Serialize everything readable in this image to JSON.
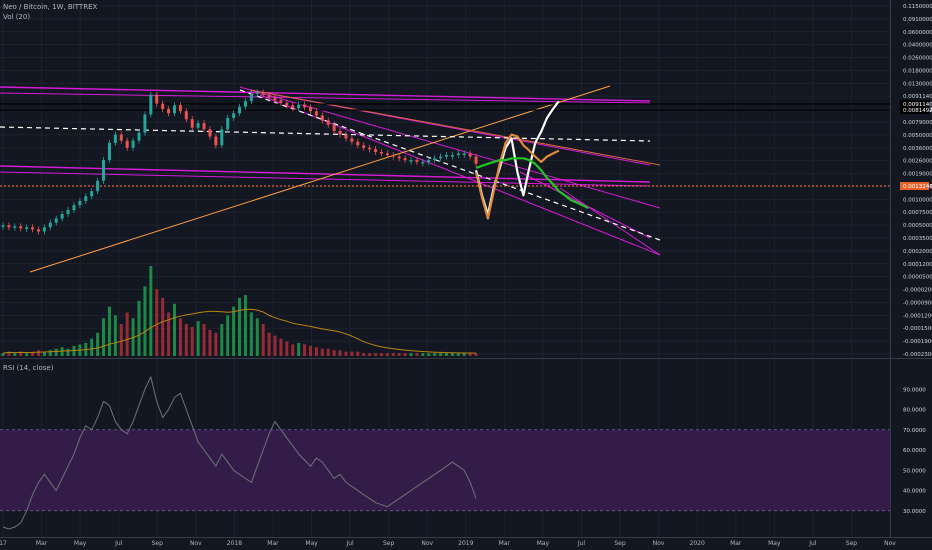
{
  "header": {
    "title": "Neo / Bitcoin, 1W, BITTREX",
    "vol_label": "Vol (20)",
    "rsi_label": "RSI (14, close)"
  },
  "colors": {
    "background": "#131722",
    "up": "#26a69a",
    "down": "#ef5350",
    "magenta": "#d81bd8",
    "orange": "#ff9f43",
    "projection_white": "#ffffff",
    "projection_orange": "#e0893a",
    "projection_green": "#22c322",
    "rsi_line": "#6d7479",
    "rsi_band": "#3a1e4f"
  },
  "chart_data": [
    {
      "type": "line",
      "title": "Neo / Bitcoin, 1W, BITTREX",
      "scale": "log",
      "x_ticks": [
        "17",
        "Mar",
        "May",
        "Jul",
        "Sep",
        "Nov",
        "2018",
        "Mar",
        "May",
        "Jul",
        "Sep",
        "Nov",
        "2019",
        "Mar",
        "May",
        "Jul",
        "Sep",
        "Nov",
        "2020",
        "Mar",
        "May",
        "Jul",
        "Sep",
        "Nov"
      ],
      "y_ticks": [
        "0.1150000",
        "0.0910000",
        "0.0600000",
        "0.0400000",
        "0.0260000",
        "0.0180000",
        "0.0130000",
        "0.0091140",
        "0.0081492",
        "0.0079000",
        "0.0050000",
        "0.0036000",
        "0.0026000",
        "0.0019000",
        "0.0013246",
        "0.0010000",
        "0.0007500",
        "0.0005000",
        "0.0003500",
        "0.0002000",
        "0.0001200",
        "0.0000500",
        "-0.0000200",
        "-0.0000900",
        "-0.0001200",
        "-0.0001500",
        "-0.0001900",
        "-0.0002300"
      ],
      "price_markers": [
        "0.0091140",
        "0.0081492",
        "0.0013246"
      ],
      "price": {
        "name": "",
        "points": [
          [
            0,
            0.00042
          ],
          [
            1,
            0.0004
          ],
          [
            2,
            0.00041
          ],
          [
            3,
            0.00039
          ],
          [
            4,
            0.0004
          ],
          [
            5,
            0.00038
          ],
          [
            6,
            0.00036
          ],
          [
            7,
            0.0004
          ],
          [
            8,
            0.00045
          ],
          [
            9,
            0.0005
          ],
          [
            10,
            0.00056
          ],
          [
            11,
            0.00062
          ],
          [
            12,
            0.0007
          ],
          [
            13,
            0.00078
          ],
          [
            14,
            0.00088
          ],
          [
            15,
            0.001
          ],
          [
            16,
            0.0013
          ],
          [
            17,
            0.0022
          ],
          [
            18,
            0.0034
          ],
          [
            19,
            0.0042
          ],
          [
            20,
            0.0036
          ],
          [
            21,
            0.003
          ],
          [
            22,
            0.0036
          ],
          [
            23,
            0.0044
          ],
          [
            24,
            0.007
          ],
          [
            25,
            0.0115
          ],
          [
            26,
            0.0092
          ],
          [
            27,
            0.008
          ],
          [
            28,
            0.0072
          ],
          [
            29,
            0.0088
          ],
          [
            30,
            0.0076
          ],
          [
            31,
            0.0062
          ],
          [
            32,
            0.005
          ],
          [
            33,
            0.0056
          ],
          [
            34,
            0.0048
          ],
          [
            35,
            0.004
          ],
          [
            36,
            0.0032
          ],
          [
            37,
            0.0048
          ],
          [
            38,
            0.0064
          ],
          [
            39,
            0.0072
          ],
          [
            40,
            0.0085
          ],
          [
            41,
            0.0098
          ],
          [
            42,
            0.0118
          ],
          [
            43,
            0.0122
          ],
          [
            44,
            0.0115
          ],
          [
            45,
            0.0108
          ],
          [
            46,
            0.01
          ],
          [
            47,
            0.0094
          ],
          [
            48,
            0.0088
          ],
          [
            49,
            0.0082
          ],
          [
            50,
            0.009
          ],
          [
            51,
            0.0084
          ],
          [
            52,
            0.0076
          ],
          [
            53,
            0.0068
          ],
          [
            54,
            0.006
          ],
          [
            55,
            0.0054
          ],
          [
            56,
            0.0046
          ],
          [
            57,
            0.0042
          ],
          [
            58,
            0.0038
          ],
          [
            59,
            0.0035
          ],
          [
            60,
            0.0032
          ],
          [
            61,
            0.003
          ],
          [
            62,
            0.0029
          ],
          [
            63,
            0.0027
          ],
          [
            64,
            0.0026
          ],
          [
            65,
            0.0025
          ],
          [
            66,
            0.0024
          ],
          [
            67,
            0.0023
          ],
          [
            68,
            0.0022
          ],
          [
            69,
            0.0022
          ],
          [
            70,
            0.0021
          ],
          [
            71,
            0.0021
          ],
          [
            72,
            0.0022
          ],
          [
            73,
            0.0023
          ],
          [
            74,
            0.0024
          ],
          [
            75,
            0.0025
          ],
          [
            76,
            0.0025
          ],
          [
            77,
            0.0026
          ],
          [
            78,
            0.0026
          ],
          [
            79,
            0.0024
          ],
          [
            80,
            0.002
          ]
        ]
      },
      "projections": [
        {
          "name": "",
          "color": "#ffffff",
          "points": [
            [
              80,
              0.0017
            ],
            [
              81,
              0.0009
            ],
            [
              82,
              0.00055
            ],
            [
              83,
              0.0011
            ],
            [
              84,
              0.0018
            ],
            [
              85,
              0.003
            ],
            [
              86,
              0.0038
            ],
            [
              87,
              0.0016
            ],
            [
              88,
              0.0009
            ],
            [
              89,
              0.0018
            ],
            [
              90,
              0.0034
            ],
            [
              91,
              0.0045
            ],
            [
              92,
              0.0064
            ],
            [
              93,
              0.008
            ],
            [
              94,
              0.0098
            ]
          ]
        },
        {
          "name": "",
          "color": "#e0893a",
          "points": [
            [
              80,
              0.0016
            ],
            [
              81,
              0.00085
            ],
            [
              82,
              0.0005
            ],
            [
              83,
              0.001
            ],
            [
              84,
              0.002
            ],
            [
              85,
              0.0034
            ],
            [
              86,
              0.0042
            ],
            [
              87,
              0.004
            ],
            [
              88,
              0.0032
            ],
            [
              89,
              0.0028
            ],
            [
              90,
              0.0024
            ],
            [
              91,
              0.0021
            ],
            [
              92,
              0.0024
            ],
            [
              93,
              0.0026
            ],
            [
              94,
              0.0028
            ]
          ]
        },
        {
          "name": "",
          "color": "#22c322",
          "points": [
            [
              80,
              0.0018
            ],
            [
              81,
              0.0019
            ],
            [
              82,
              0.002
            ],
            [
              83,
              0.0021
            ],
            [
              84,
              0.0022
            ],
            [
              85,
              0.0022
            ],
            [
              86,
              0.0023
            ],
            [
              87,
              0.0023
            ],
            [
              88,
              0.0023
            ],
            [
              89,
              0.0022
            ],
            [
              90,
              0.002
            ],
            [
              91,
              0.0017
            ],
            [
              92,
              0.0014
            ],
            [
              93,
              0.0012
            ],
            [
              94,
              0.001
            ],
            [
              95,
              0.0009
            ],
            [
              96,
              0.0008
            ],
            [
              97,
              0.00075
            ],
            [
              98,
              0.0007
            ],
            [
              99,
              0.00065
            ]
          ]
        }
      ]
    },
    {
      "type": "bar",
      "title": "Vol (20)",
      "values": [
        2,
        3,
        2,
        3,
        2,
        3,
        4,
        3,
        4,
        5,
        6,
        5,
        7,
        8,
        9,
        12,
        16,
        26,
        34,
        28,
        22,
        30,
        26,
        38,
        48,
        62,
        46,
        40,
        30,
        36,
        26,
        22,
        20,
        24,
        22,
        18,
        16,
        22,
        28,
        34,
        40,
        42,
        30,
        26,
        22,
        16,
        14,
        12,
        10,
        8,
        9,
        8,
        7,
        6,
        5,
        5,
        4,
        4,
        3,
        3,
        3,
        2,
        2,
        2,
        2,
        2,
        2,
        2,
        2,
        2,
        2,
        2,
        2,
        2,
        2,
        2,
        2,
        2,
        2,
        2,
        2
      ]
    },
    {
      "type": "line",
      "title": "RSI (14, close)",
      "ylim": [
        20,
        100
      ],
      "y_ticks": [
        "90.0000",
        "80.0000",
        "70.0000",
        "60.0000",
        "50.0000",
        "40.0000",
        "30.0000"
      ],
      "band": [
        30,
        70
      ],
      "values": [
        22,
        21,
        22,
        24,
        30,
        38,
        44,
        48,
        44,
        40,
        46,
        52,
        58,
        66,
        72,
        70,
        76,
        84,
        82,
        74,
        70,
        68,
        74,
        82,
        90,
        96,
        84,
        76,
        80,
        86,
        88,
        80,
        72,
        64,
        60,
        56,
        52,
        58,
        54,
        50,
        48,
        46,
        44,
        52,
        60,
        68,
        74,
        70,
        66,
        62,
        58,
        55,
        52,
        56,
        54,
        50,
        46,
        48,
        44,
        42,
        40,
        38,
        36,
        34,
        33,
        32,
        34,
        36,
        38,
        40,
        42,
        44,
        46,
        48,
        50,
        52,
        54,
        52,
        50,
        44,
        36
      ]
    }
  ]
}
